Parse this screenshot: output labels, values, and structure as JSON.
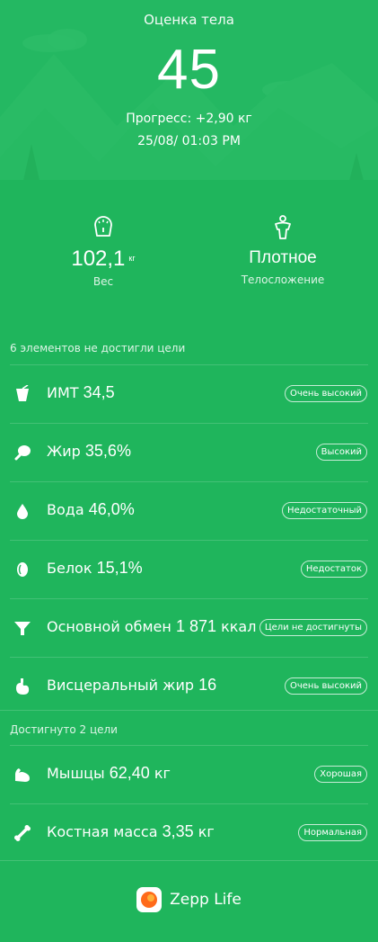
{
  "hero": {
    "title": "Оценка тела",
    "score": "45",
    "progress": "Прогресс: +2,90 кг",
    "date": "25/08/ 01:03 PM"
  },
  "stats": {
    "weight": {
      "value": "102,1",
      "unit": "кг",
      "label": "Вес",
      "icon": "scale-icon"
    },
    "build": {
      "value": "Плотное",
      "label": "Телосложение",
      "icon": "body-figure-icon"
    }
  },
  "section_not_met": {
    "label": "6 элементов не достигли цели"
  },
  "items_not_met": [
    {
      "name": "ИМТ",
      "value": "34,5",
      "unit": "",
      "badge": "Очень высокий",
      "icon": "bmi-cup-icon"
    },
    {
      "name": "Жир",
      "value": "35,6",
      "unit": "%",
      "badge": "Высокий",
      "icon": "fat-drumstick-icon"
    },
    {
      "name": "Вода",
      "value": "46,0",
      "unit": "%",
      "badge": "Недостаточный",
      "icon": "water-drop-icon"
    },
    {
      "name": "Белок",
      "value": "15,1",
      "unit": "%",
      "badge": "Недостаток",
      "icon": "protein-egg-icon"
    },
    {
      "name": "Основной обмен",
      "value": "1 871",
      "unit": "ккал",
      "badge": "Цели не достигнуты",
      "icon": "metabolism-funnel-icon"
    },
    {
      "name": "Висцеральный жир",
      "value": "16",
      "unit": "",
      "badge": "Очень высокий",
      "icon": "visceral-stomach-icon"
    }
  ],
  "section_met": {
    "label": "Достигнуто 2 цели"
  },
  "items_met": [
    {
      "name": "Мышцы",
      "value": "62,40",
      "unit": "кг",
      "badge": "Хорошая",
      "icon": "muscle-arm-icon"
    },
    {
      "name": "Костная масса",
      "value": "3,35",
      "unit": "кг",
      "badge": "Нормальная",
      "icon": "bone-icon"
    }
  ],
  "footer": {
    "app_name": "Zepp Life",
    "icon": "zepp-logo-icon"
  },
  "colors": {
    "background": "#1fb55c",
    "hero_mountain": "#2bbd67",
    "logo_orange": "#ff6a1a"
  }
}
